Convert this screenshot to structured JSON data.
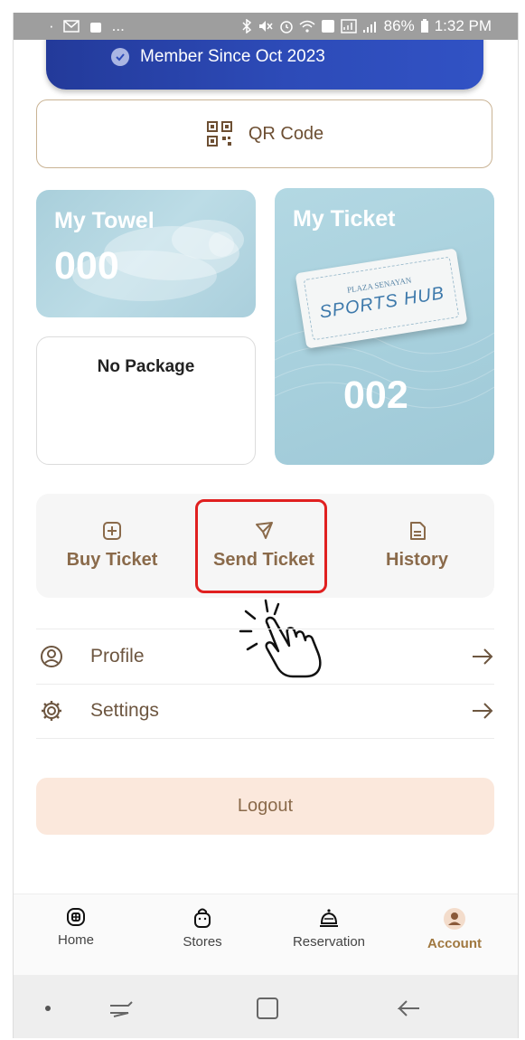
{
  "status_bar": {
    "battery": "86%",
    "time": "1:32 PM"
  },
  "member": {
    "since_text": "Member Since Oct 2023"
  },
  "qr": {
    "label": "QR Code",
    "icon": "qr-icon"
  },
  "towel_card": {
    "title": "My Towel",
    "count": "000"
  },
  "ticket_card": {
    "title": "My Ticket",
    "count": "002",
    "image_text_top": "PLAZA SENAYAN",
    "image_text_main": "SPORTS HUB"
  },
  "package_card": {
    "label": "No Package"
  },
  "actions": [
    {
      "label": "Buy Ticket",
      "icon": "plus-square-icon"
    },
    {
      "label": "Send Ticket",
      "icon": "send-icon"
    },
    {
      "label": "History",
      "icon": "document-icon"
    }
  ],
  "menu": [
    {
      "label": "Profile",
      "icon": "user-circle-icon"
    },
    {
      "label": "Settings",
      "icon": "gear-icon"
    }
  ],
  "logout": {
    "label": "Logout"
  },
  "bottom_nav": [
    {
      "label": "Home",
      "icon": "home-icon"
    },
    {
      "label": "Stores",
      "icon": "bag-icon"
    },
    {
      "label": "Reservation",
      "icon": "bell-icon"
    },
    {
      "label": "Account",
      "icon": "avatar-icon",
      "active": true
    }
  ],
  "colors": {
    "accent": "#8a6a4a",
    "highlight": "#e02020",
    "card_blue": "#2d4bb8",
    "logout_bg": "#fbe8dc"
  }
}
